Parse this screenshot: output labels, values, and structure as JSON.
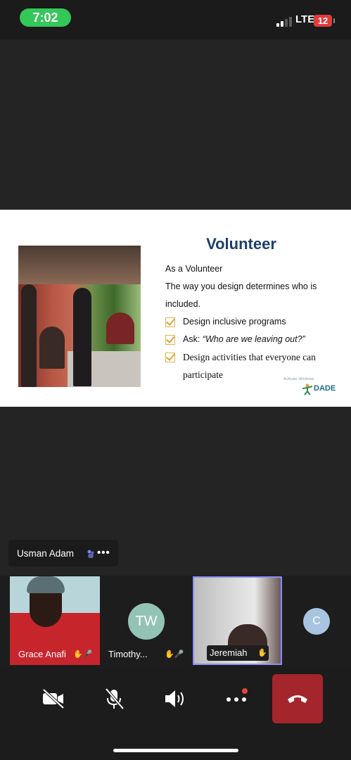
{
  "status_bar": {
    "time": "7:02",
    "network": "LTE",
    "battery": "12"
  },
  "slide": {
    "title": "Volunteer",
    "line1": "As a Volunteer",
    "line2": "The way you design determines who is",
    "line3": "included.",
    "bullets": [
      {
        "prefix": "",
        "text": "Design inclusive programs"
      },
      {
        "prefix": "Ask: ",
        "text": "“Who are we leaving out?”"
      },
      {
        "prefix": "",
        "text": "Design activities that everyone can"
      }
    ],
    "bullet3_cont": "participate",
    "watermark": "Activate Windows",
    "logo_text": "DADE"
  },
  "speaker_tag": {
    "name": "Usman Adam"
  },
  "participants": [
    {
      "name": "Grace Anafi"
    },
    {
      "name": "Timothy...",
      "initials": "TW"
    },
    {
      "name": "Jeremiah"
    },
    {
      "initials": "C"
    }
  ],
  "colors": {
    "accent": "#8e8cf3",
    "end_call": "#a4262c",
    "time_pill": "#34c759",
    "battery": "#e23b3b",
    "slide_title": "#1f3f66"
  },
  "icons": [
    "video-off-icon",
    "mic-off-icon",
    "speaker-icon",
    "more-icon",
    "hang-up-icon"
  ]
}
